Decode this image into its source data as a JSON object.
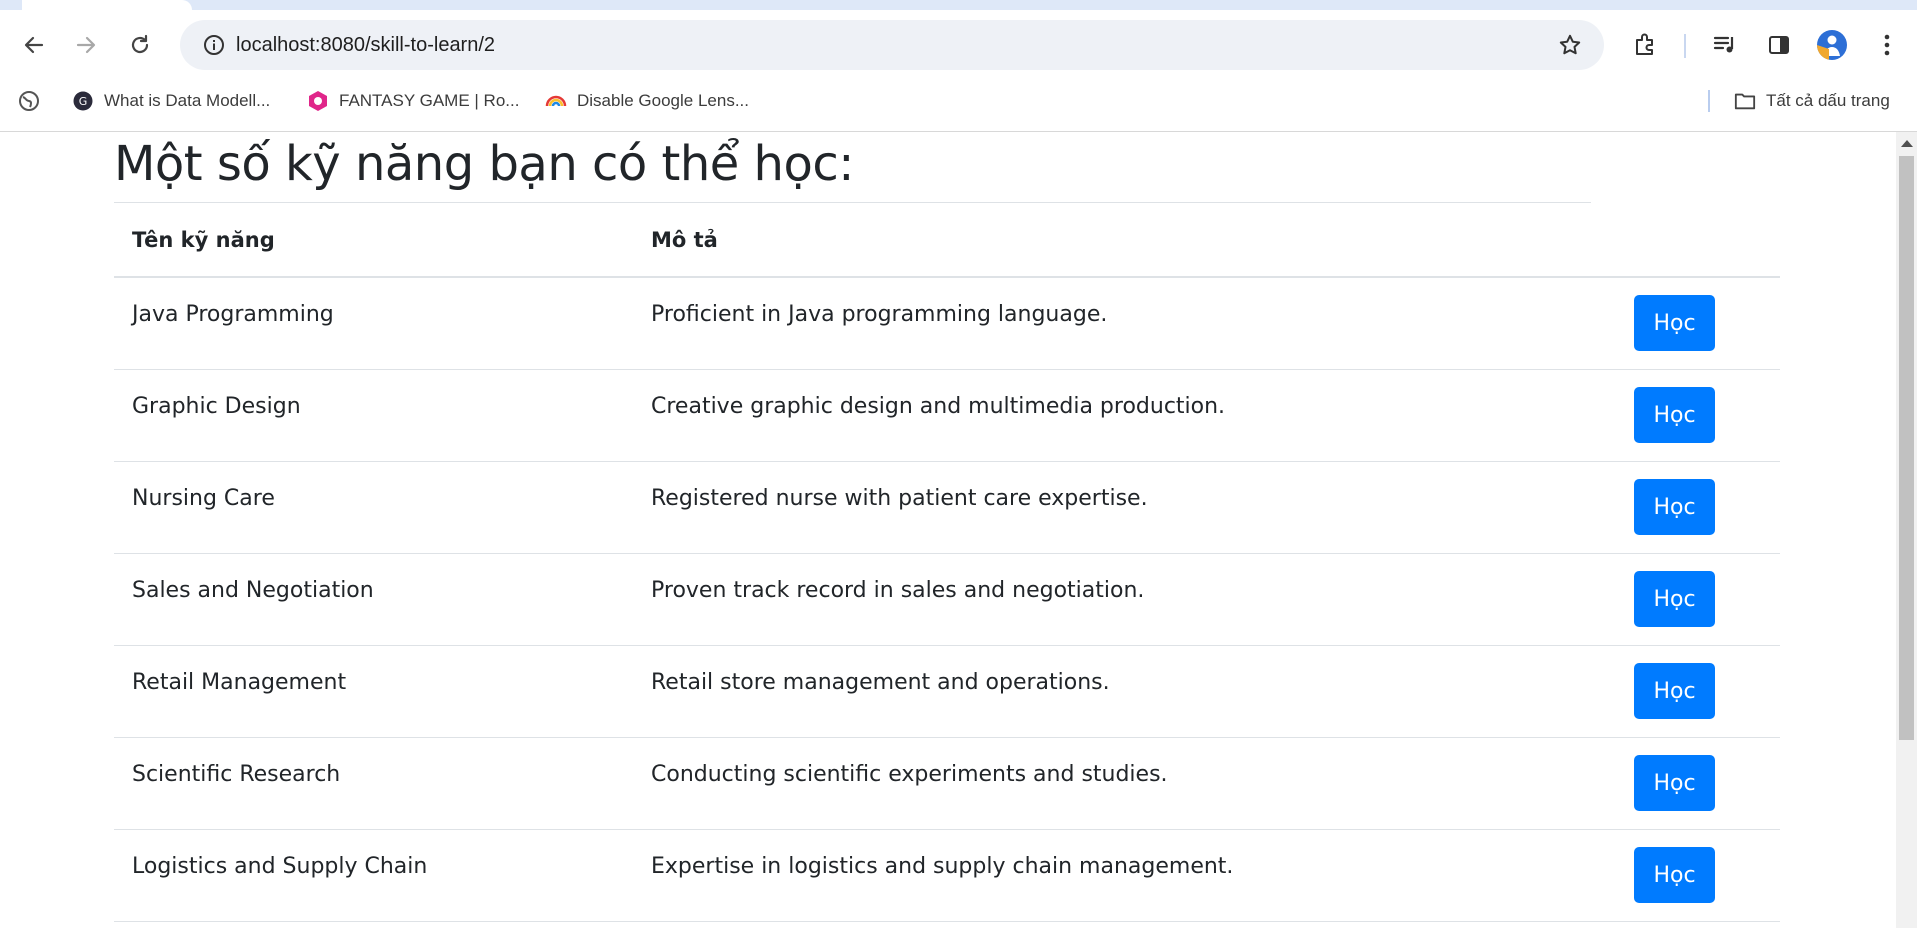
{
  "browser": {
    "url": "localhost:8080/skill-to-learn/2",
    "bookmarks": [
      {
        "label": "What is Data Modell...",
        "icon": "data-modelling-favicon"
      },
      {
        "label": "FANTASY GAME | Ro...",
        "icon": "fantasy-game-favicon"
      },
      {
        "label": "Disable Google Lens...",
        "icon": "rainbow-favicon"
      }
    ],
    "all_bookmarks_label": "Tất cả dấu trang"
  },
  "page": {
    "title": "Một số kỹ năng bạn có thể học:",
    "columns": [
      "Tên kỹ năng",
      "Mô tả"
    ],
    "button_label": "Học",
    "skills": [
      {
        "name": "Java Programming",
        "description": "Proficient in Java programming language."
      },
      {
        "name": "Graphic Design",
        "description": "Creative graphic design and multimedia production."
      },
      {
        "name": "Nursing Care",
        "description": "Registered nurse with patient care expertise."
      },
      {
        "name": "Sales and Negotiation",
        "description": "Proven track record in sales and negotiation."
      },
      {
        "name": "Retail Management",
        "description": "Retail store management and operations."
      },
      {
        "name": "Scientific Research",
        "description": "Conducting scientific experiments and studies."
      },
      {
        "name": "Logistics and Supply Chain",
        "description": "Expertise in logistics and supply chain management."
      }
    ]
  },
  "colors": {
    "primary_button": "#007bff",
    "text": "#212529",
    "border": "#dee2e6"
  }
}
